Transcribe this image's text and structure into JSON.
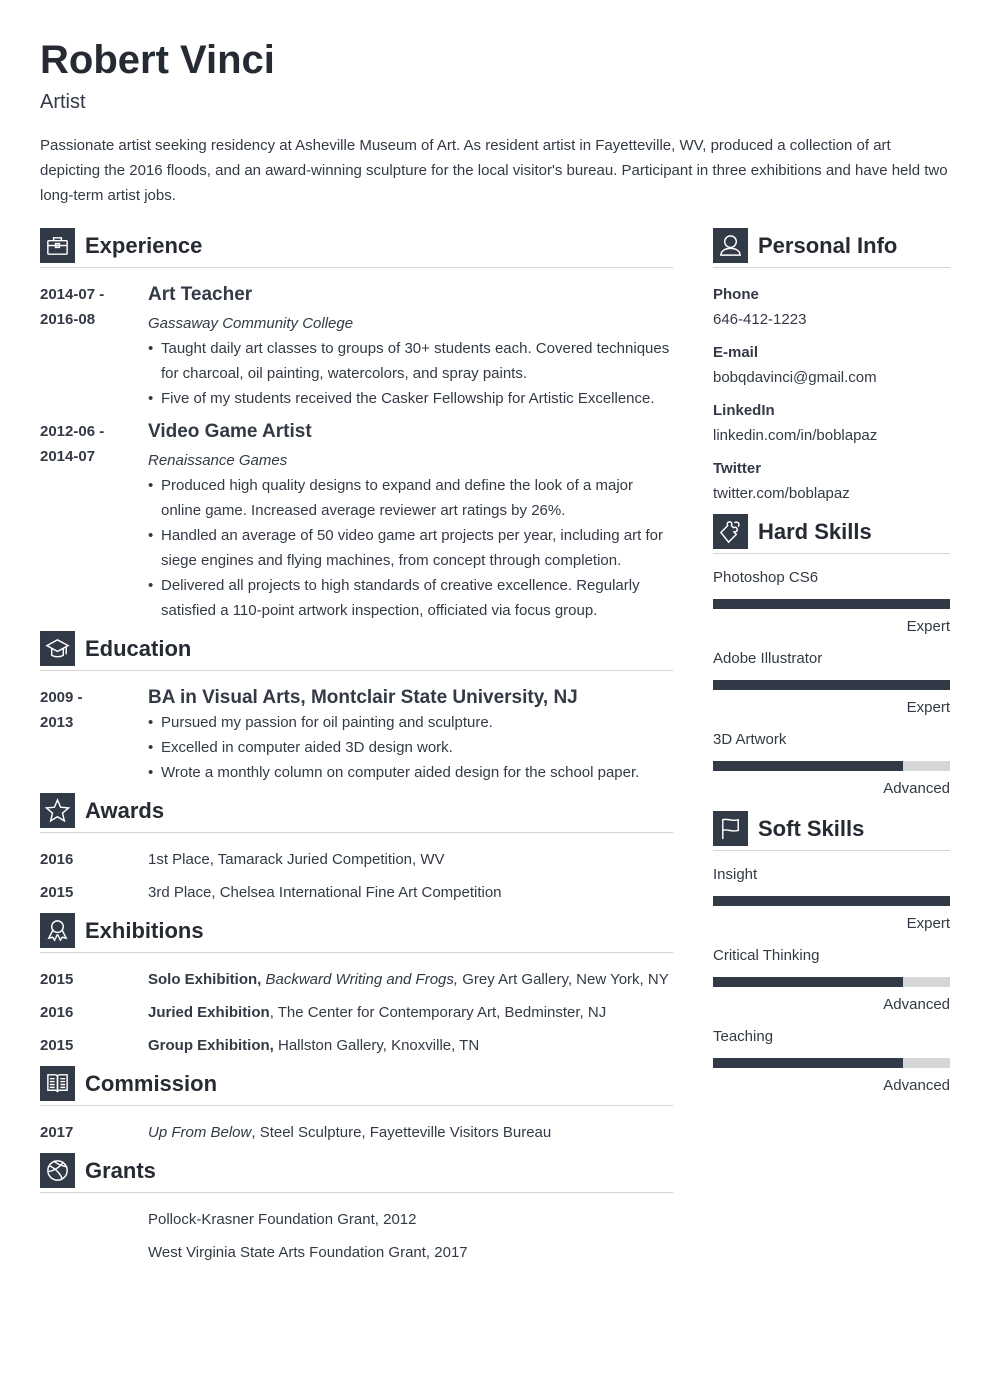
{
  "header": {
    "name": "Robert Vinci",
    "title": "Artist",
    "summary": "Passionate artist seeking residency at Asheville Museum of Art. As resident artist in Fayetteville, WV, produced a collection of art depicting the 2016 floods, and an award-winning sculpture for the local visitor's bureau. Participant in three exhibitions and have held two long-term artist jobs."
  },
  "experience": {
    "heading": "Experience",
    "icon": "briefcase-icon",
    "items": [
      {
        "date_start": "2014-07 -",
        "date_end": "2016-08",
        "title": "Art Teacher",
        "company": "Gassaway Community College",
        "bullets": [
          "Taught daily art classes to groups of 30+ students each. Covered techniques for charcoal, oil painting, watercolors, and spray paints.",
          "Five of my students received the Casker Fellowship for Artistic Excellence."
        ]
      },
      {
        "date_start": "2012-06 -",
        "date_end": "2014-07",
        "title": "Video Game Artist",
        "company": "Renaissance Games",
        "bullets": [
          "Produced high quality designs to expand and define the look of a major online game. Increased average reviewer art ratings by 26%.",
          "Handled an average of 50 video game art projects per year, including art for siege engines and flying machines, from concept through completion.",
          "Delivered all projects to high standards of creative excellence. Regularly satisfied a 110-point artwork inspection, officiated via focus group."
        ]
      }
    ]
  },
  "education": {
    "heading": "Education",
    "icon": "graduation-cap-icon",
    "items": [
      {
        "date_start": "2009 -",
        "date_end": "2013",
        "title": "BA in Visual Arts, Montclair State University, NJ",
        "bullets": [
          "Pursued my passion for oil painting and sculpture.",
          "Excelled in computer aided 3D design work.",
          "Wrote a monthly column on computer aided design for the school paper."
        ]
      }
    ]
  },
  "awards": {
    "heading": "Awards",
    "icon": "star-icon",
    "items": [
      {
        "year": "2016",
        "text": "1st Place, Tamarack Juried Competition, WV"
      },
      {
        "year": "2015",
        "text": "3rd Place, Chelsea International Fine Art Competition"
      }
    ]
  },
  "exhibitions": {
    "heading": "Exhibitions",
    "icon": "ribbon-icon",
    "items": [
      {
        "year": "2015",
        "bold": "Solo Exhibition,",
        "italic": " Backward Writing and Frogs,",
        "rest": " Grey Art Gallery, New York, NY"
      },
      {
        "year": "2016",
        "bold": "Juried Exhibition",
        "italic": "",
        "rest": ", The Center for Contemporary Art, Bedminster, NJ"
      },
      {
        "year": "2015",
        "bold": "Group Exhibition,",
        "italic": "",
        "rest": " Hallston Gallery, Knoxville, TN"
      }
    ]
  },
  "commission": {
    "heading": "Commission",
    "icon": "book-icon",
    "items": [
      {
        "year": "2017",
        "italic": "Up From Below",
        "rest": ", Steel Sculpture, Fayetteville Visitors Bureau"
      }
    ]
  },
  "grants": {
    "heading": "Grants",
    "icon": "globe-icon",
    "items": [
      "Pollock-Krasner Foundation Grant, 2012",
      "West Virginia State Arts Foundation Grant, 2017"
    ]
  },
  "personal_info": {
    "heading": "Personal Info",
    "icon": "person-icon",
    "items": [
      {
        "label": "Phone",
        "value": "646-412-1223"
      },
      {
        "label": "E-mail",
        "value": "bobqdavinci@gmail.com"
      },
      {
        "label": "LinkedIn",
        "value": "linkedin.com/in/boblapaz"
      },
      {
        "label": "Twitter",
        "value": "twitter.com/boblapaz"
      }
    ]
  },
  "hard_skills": {
    "heading": "Hard Skills",
    "icon": "puzzle-icon",
    "items": [
      {
        "name": "Photoshop CS6",
        "level": "Expert",
        "proficiency": 1.0
      },
      {
        "name": "Adobe Illustrator",
        "level": "Expert",
        "proficiency": 1.0
      },
      {
        "name": "3D Artwork",
        "level": "Advanced",
        "proficiency": 0.8
      }
    ]
  },
  "soft_skills": {
    "heading": "Soft Skills",
    "icon": "flag-icon",
    "items": [
      {
        "name": "Insight",
        "level": "Expert",
        "proficiency": 1.0
      },
      {
        "name": "Critical Thinking",
        "level": "Advanced",
        "proficiency": 0.8
      },
      {
        "name": "Teaching",
        "level": "Advanced",
        "proficiency": 0.8
      }
    ]
  },
  "colors": {
    "accent": "#323a47",
    "text": "#333a45",
    "bar_track": "#d4d6d7",
    "divider": "#d4d4d4"
  }
}
